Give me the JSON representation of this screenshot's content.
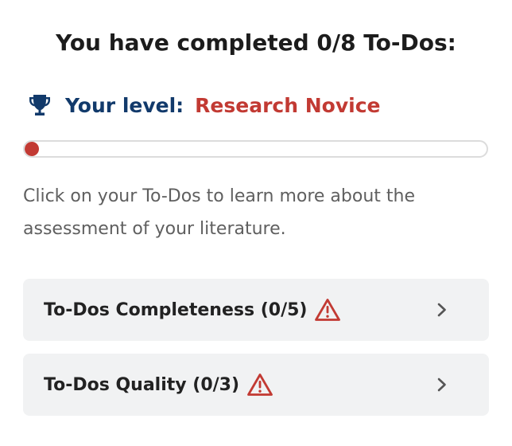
{
  "header": {
    "title": "You have completed 0/8 To-Dos:"
  },
  "level": {
    "label": "Your level:",
    "value": "Research Novice",
    "icon": "trophy-icon",
    "progress_fraction": 0.0
  },
  "description": "Click on your To-Dos to learn more about the assessment of your literature.",
  "todos": [
    {
      "label": "To-Dos Completeness (0/5)",
      "icon": "warning-icon",
      "chevron": "chevron-right-icon"
    },
    {
      "label": "To-Dos Quality (0/3)",
      "icon": "warning-icon",
      "chevron": "chevron-right-icon"
    }
  ],
  "colors": {
    "heading": "#1c1c1c",
    "level_label": "#123a6b",
    "accent_red": "#c23a33",
    "card_bg": "#f1f2f3",
    "body_text": "#5f5f5f"
  }
}
